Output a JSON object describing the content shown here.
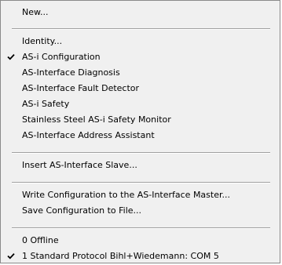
{
  "menu": {
    "items": [
      {
        "label": "New...",
        "checked": false
      },
      {
        "label": "Identity...",
        "checked": false
      },
      {
        "label": "AS-i Configuration",
        "checked": true
      },
      {
        "label": "AS-Interface Diagnosis",
        "checked": false
      },
      {
        "label": "AS-Interface Fault Detector",
        "checked": false
      },
      {
        "label": "AS-i Safety",
        "checked": false
      },
      {
        "label": "Stainless Steel AS-i Safety Monitor",
        "checked": false
      },
      {
        "label": "AS-Interface Address Assistant",
        "checked": false
      },
      {
        "label": "Insert AS-Interface Slave...",
        "checked": false
      },
      {
        "label": "Write Configuration to the AS-Interface Master...",
        "checked": false
      },
      {
        "label": "Save Configuration to File...",
        "checked": false
      },
      {
        "label": "0 Offline",
        "checked": false
      },
      {
        "label": "1 Standard Protocol Bihl+Wiedemann: COM 5",
        "checked": true
      }
    ],
    "check_icon": "checkmark-icon"
  }
}
